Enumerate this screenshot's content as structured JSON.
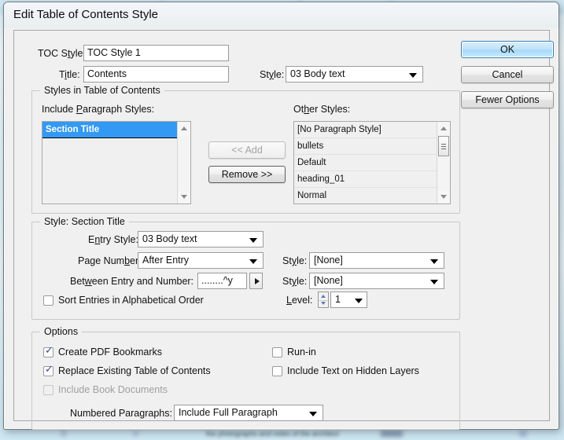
{
  "window": {
    "title": "Edit Table of Contents Style"
  },
  "top": {
    "toc_style_label": "TOC Style:",
    "toc_style_value": "TOC Style 1",
    "title_label": "Title:",
    "title_value": "Contents",
    "title_style_label": "Style:",
    "title_style_value": "03 Body text"
  },
  "buttons": {
    "ok": "OK",
    "cancel": "Cancel",
    "fewer_options": "Fewer Options",
    "add": "<< Add",
    "remove": "Remove >>"
  },
  "styles_group": {
    "title": "Styles in Table of Contents",
    "include_label": "Include Paragraph Styles:",
    "other_label": "Other Styles:",
    "included": [
      {
        "label": "Section Title",
        "selected": true
      }
    ],
    "other": [
      {
        "label": "[No Paragraph Style]"
      },
      {
        "label": "bullets"
      },
      {
        "label": "Default"
      },
      {
        "label": "heading_01"
      },
      {
        "label": "Normal"
      },
      {
        "label": ""
      }
    ]
  },
  "style_section": {
    "title": "Style: Section Title",
    "entry_style_label": "Entry Style:",
    "entry_style_value": "03 Body text",
    "page_number_label": "Page Number:",
    "page_number_value": "After Entry",
    "page_number_style_label": "Style:",
    "page_number_style_value": "[None]",
    "between_label": "Between Entry and Number:",
    "between_value": "........^y",
    "between_style_label": "Style:",
    "between_style_value": "[None]",
    "level_label": "Level:",
    "level_value": "1",
    "sort_label": "Sort Entries in Alphabetical Order",
    "sort_checked": false
  },
  "options": {
    "title": "Options",
    "create_pdf_bookmarks": {
      "label": "Create PDF Bookmarks",
      "checked": true,
      "disabled": false
    },
    "replace_existing": {
      "label": "Replace Existing Table of Contents",
      "checked": true,
      "disabled": false
    },
    "include_book_documents": {
      "label": "Include Book Documents",
      "checked": false,
      "disabled": true
    },
    "run_in": {
      "label": "Run-in",
      "checked": false,
      "disabled": false
    },
    "include_hidden": {
      "label": "Include Text on Hidden Layers",
      "checked": false,
      "disabled": false
    },
    "numbered_paragraphs_label": "Numbered Paragraphs:",
    "numbered_paragraphs_value": "Include Full Paragraph"
  },
  "colors": {
    "selection": "#3399f3",
    "default_button_border": "#3c7fb1",
    "dialog_bg": "#f0f0f0",
    "backdrop": "#dff0f8"
  }
}
